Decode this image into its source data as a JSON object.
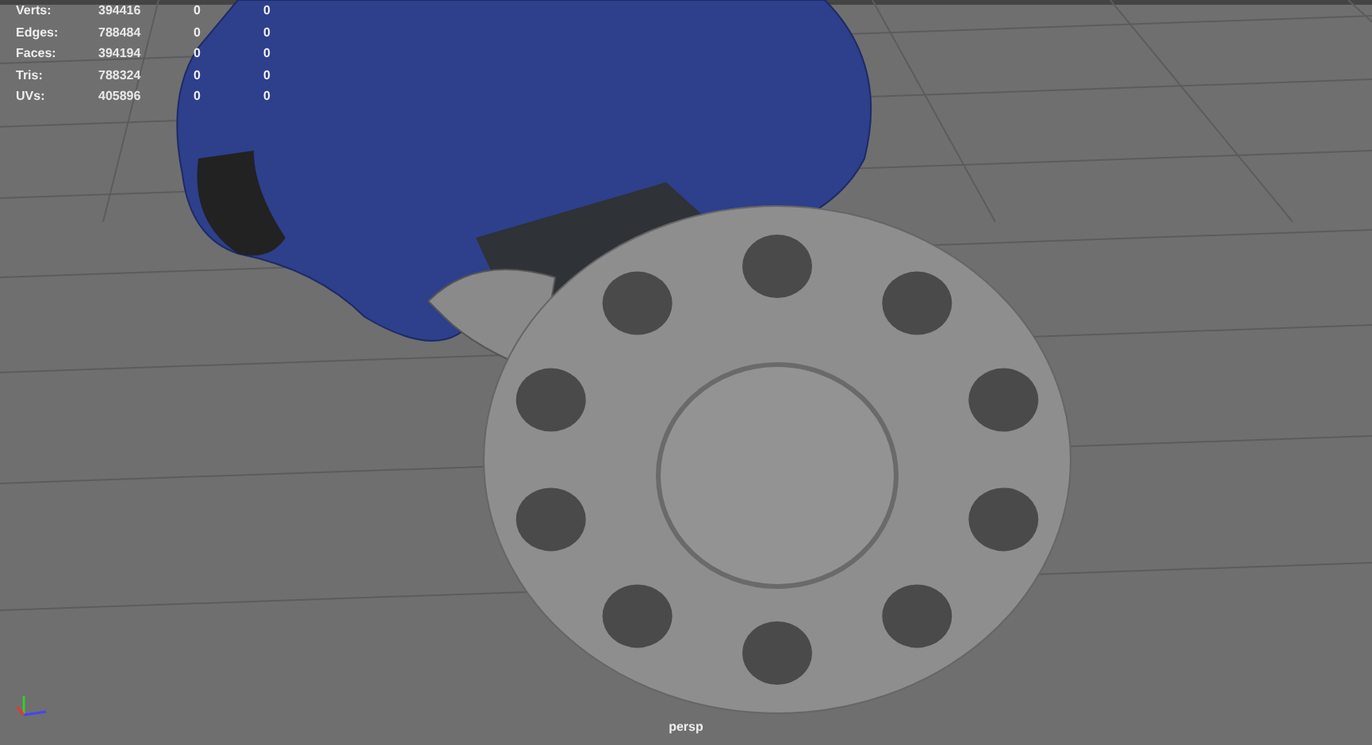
{
  "hud": {
    "stats": [
      {
        "label": "Verts:",
        "value": "394416",
        "column_2": "0",
        "column_3": "0"
      },
      {
        "label": "Edges:",
        "value": "788484",
        "column_2": "0",
        "column_3": "0"
      },
      {
        "label": "Faces:",
        "value": "394194",
        "column_2": "0",
        "column_3": "0"
      },
      {
        "label": "Tris:",
        "value": "788324",
        "column_2": "0",
        "column_3": "0"
      },
      {
        "label": "UVs:",
        "value": "405896",
        "column_2": "0",
        "column_3": "0"
      }
    ]
  },
  "camera_label": "persp"
}
